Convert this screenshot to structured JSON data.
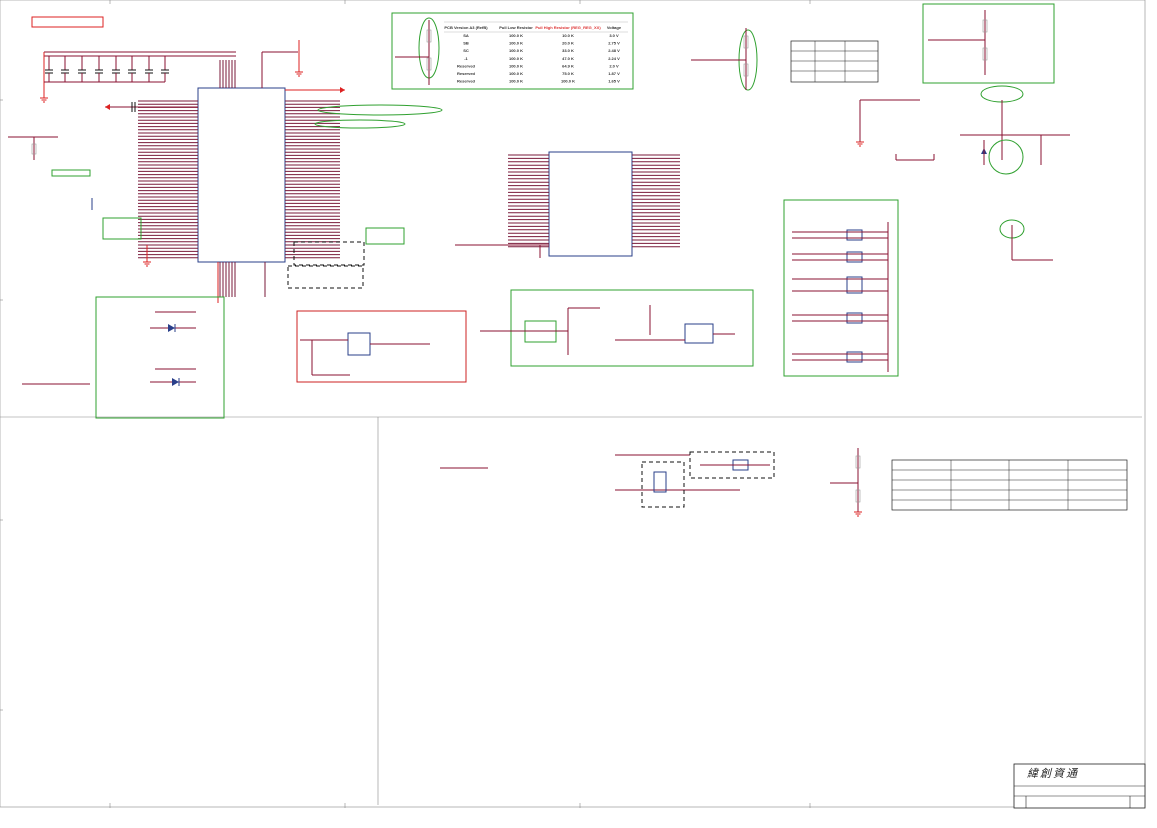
{
  "title_block": {
    "logo_text": "緯創資通"
  },
  "voltage_table": {
    "headers": [
      "PCB Version A3 (RefB)",
      "Pull Low Resistor",
      "Pull High Resistor (REG_REG_XX)",
      "Voltage"
    ],
    "rows": [
      [
        "SA",
        "100.0 K",
        "10.0 K",
        "3.0 V"
      ],
      [
        "SB",
        "100.0 K",
        "20.0 K",
        "2.75 V"
      ],
      [
        "SC",
        "100.0 K",
        "33.0 K",
        "2.48 V"
      ],
      [
        "-1",
        "100.0 K",
        "47.0 K",
        "2.24 V"
      ],
      [
        "Reserved",
        "100.0 K",
        "64.9 K",
        "2.0 V"
      ],
      [
        "Reserved",
        "100.0 K",
        "75.0 K",
        "1.87 V"
      ],
      [
        "Reserved",
        "100.0 K",
        "100.0 K",
        "1.65 V"
      ]
    ]
  },
  "colors": {
    "wire": "#8a1030",
    "component_outline": "#2a3f8a",
    "highlight": "#2fa02f",
    "power_ground": "#d22222"
  }
}
